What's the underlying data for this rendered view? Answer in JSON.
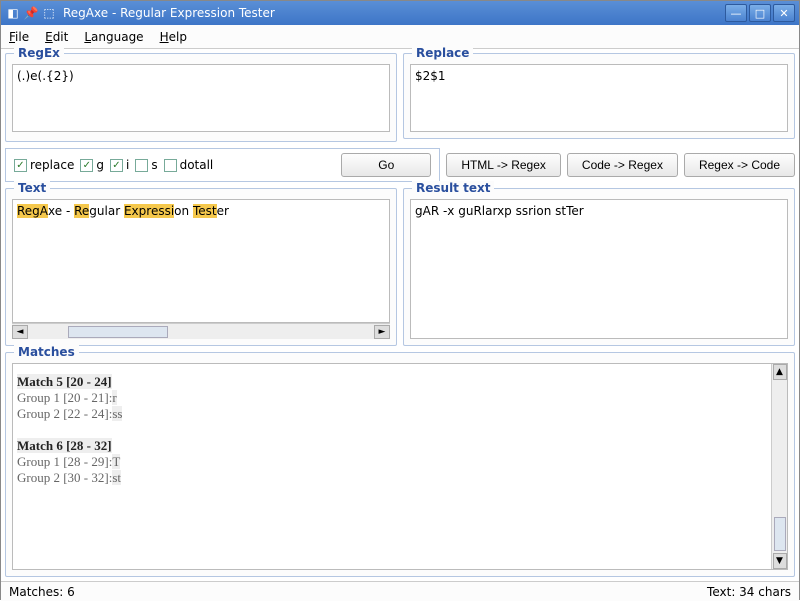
{
  "window": {
    "title": "RegAxe - Regular Expression Tester"
  },
  "menu": {
    "file": "File",
    "edit": "Edit",
    "language": "Language",
    "help": "Help"
  },
  "panels": {
    "regex_title": "RegEx",
    "replace_title": "Replace",
    "text_title": "Text",
    "result_title": "Result text",
    "matches_title": "Matches"
  },
  "regex": {
    "value": "(.)e(.{2})"
  },
  "replace": {
    "value": "$2$1"
  },
  "options": {
    "replace_label": "replace",
    "replace_checked": true,
    "g_label": "g",
    "g_checked": true,
    "i_label": "i",
    "i_checked": true,
    "s_label": "s",
    "s_checked": false,
    "dotall_label": "dotall",
    "dotall_checked": false
  },
  "buttons": {
    "go": "Go",
    "html_regex": "HTML -> Regex",
    "code_regex": "Code -> Regex",
    "regex_code": "Regex -> Code"
  },
  "text": {
    "seg1": "RegA",
    "seg2": "xe -",
    "seg3": " ",
    "seg4": "Re",
    "seg5": "gular ",
    "seg6": "Expressi",
    "seg7": "on ",
    "seg8": "Test",
    "seg9": "er"
  },
  "result": {
    "value": "gAR -x guRlarxp ssrion stTer"
  },
  "matches": [
    {
      "header": "Match 5 [20 - 24]",
      "g1": "Group 1 [20 - 21]:",
      "g1v": "r",
      "g2": "Group 2 [22 - 24]:",
      "g2v": "ss"
    },
    {
      "header": "Match 6 [28 - 32]",
      "g1": "Group 1 [28 - 29]:",
      "g1v": "T",
      "g2": "Group 2 [30 - 32]:",
      "g2v": "st"
    }
  ],
  "status": {
    "matches": "Matches: 6",
    "text_len": "Text: 34 chars"
  }
}
